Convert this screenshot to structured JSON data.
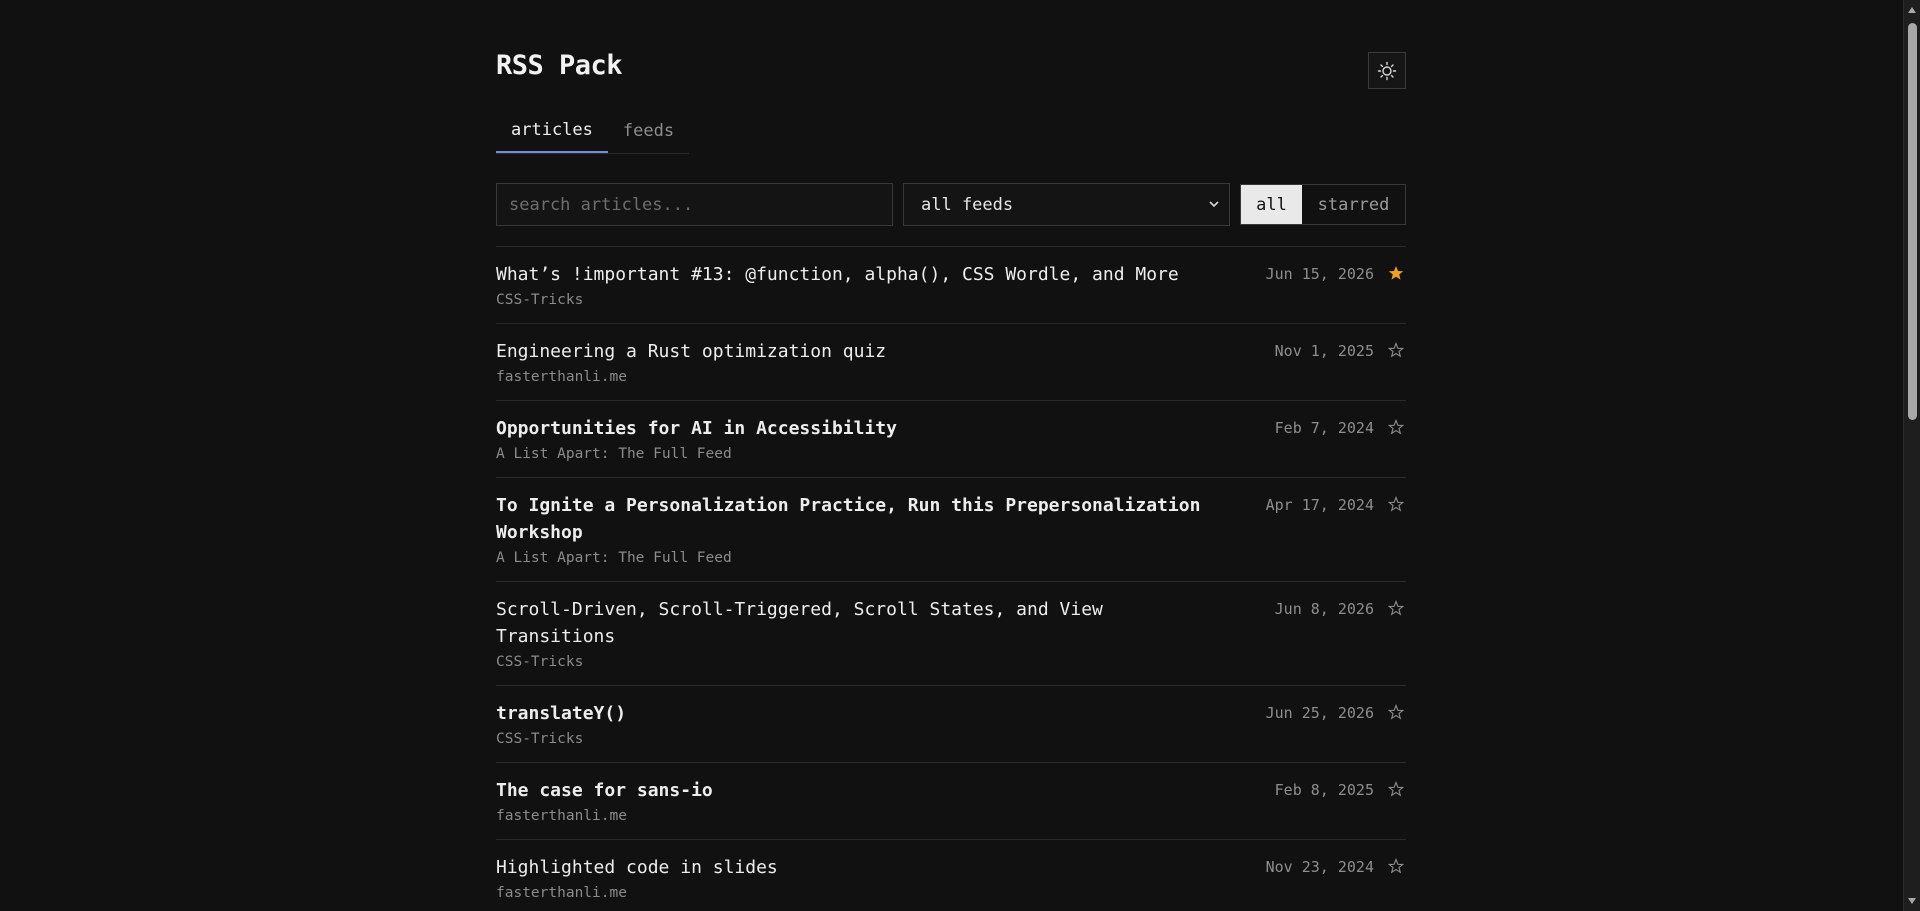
{
  "header": {
    "title": "RSS Pack",
    "theme_toggle_icon": "sun-icon"
  },
  "tabs": [
    {
      "label": "articles",
      "active": true
    },
    {
      "label": "feeds",
      "active": false
    }
  ],
  "filters": {
    "search_placeholder": "search articles...",
    "search_value": "",
    "feed_select_value": "all feeds",
    "segment": [
      {
        "label": "all",
        "active": true
      },
      {
        "label": "starred",
        "active": false
      }
    ]
  },
  "articles": [
    {
      "title": "What’s !important #13: @function, alpha(), CSS Wordle, and More",
      "source": "CSS-Tricks",
      "date": "Jun 15, 2026",
      "starred": true,
      "bold": false
    },
    {
      "title": "Engineering a Rust optimization quiz",
      "source": "fasterthanli.me",
      "date": "Nov 1, 2025",
      "starred": false,
      "bold": false
    },
    {
      "title": "Opportunities for AI in Accessibility",
      "source": "A List Apart: The Full Feed",
      "date": "Feb 7, 2024",
      "starred": false,
      "bold": true
    },
    {
      "title": "To Ignite a Personalization Practice, Run this Prepersonalization Workshop",
      "source": "A List Apart: The Full Feed",
      "date": "Apr 17, 2024",
      "starred": false,
      "bold": true
    },
    {
      "title": "Scroll-Driven, Scroll-Triggered, Scroll States, and View Transitions",
      "source": "CSS-Tricks",
      "date": "Jun 8, 2026",
      "starred": false,
      "bold": false
    },
    {
      "title": "translateY()",
      "source": "CSS-Tricks",
      "date": "Jun 25, 2026",
      "starred": false,
      "bold": true
    },
    {
      "title": "The case for sans-io",
      "source": "fasterthanli.me",
      "date": "Feb 8, 2025",
      "starred": false,
      "bold": true
    },
    {
      "title": "Highlighted code in slides",
      "source": "fasterthanli.me",
      "date": "Nov 23, 2024",
      "starred": false,
      "bold": false
    }
  ],
  "colors": {
    "background": "#111111",
    "accent": "#6f8fd8",
    "star_active": "#f0a020",
    "star_inactive": "#8e8e8e"
  }
}
